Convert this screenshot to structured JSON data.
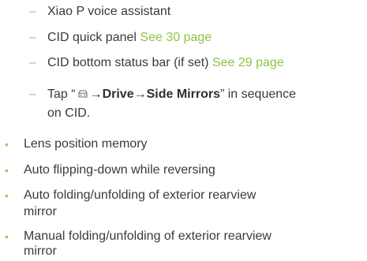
{
  "bullet_color": "#9dc85b",
  "link_color": "#8fc444",
  "sub_items": [
    {
      "dash": "–",
      "text": "Xiao P voice assistant"
    },
    {
      "dash": "–",
      "text": "CID quick panel",
      "link": "See 30 page"
    },
    {
      "dash": "–",
      "text": "CID bottom status bar (if set)",
      "link": "See 29 page"
    }
  ],
  "tap_instruction": {
    "dash": "–",
    "prefix": "Tap “",
    "icon": "car-settings-icon",
    "arrow1": "→",
    "step1": "Drive",
    "arrow2": "→",
    "step2": "Side Mirrors",
    "suffix": "” in sequence",
    "line2": "on CID."
  },
  "features": [
    {
      "bullet": "•",
      "lines": [
        "Lens position memory"
      ]
    },
    {
      "bullet": "•",
      "lines": [
        "Auto flipping-down while reversing"
      ]
    },
    {
      "bullet": "•",
      "lines": [
        "Auto folding/unfolding of exterior rearview",
        "mirror"
      ]
    },
    {
      "bullet": "•",
      "lines": [
        "Manual folding/unfolding of exterior rearview",
        "mirror"
      ]
    }
  ]
}
